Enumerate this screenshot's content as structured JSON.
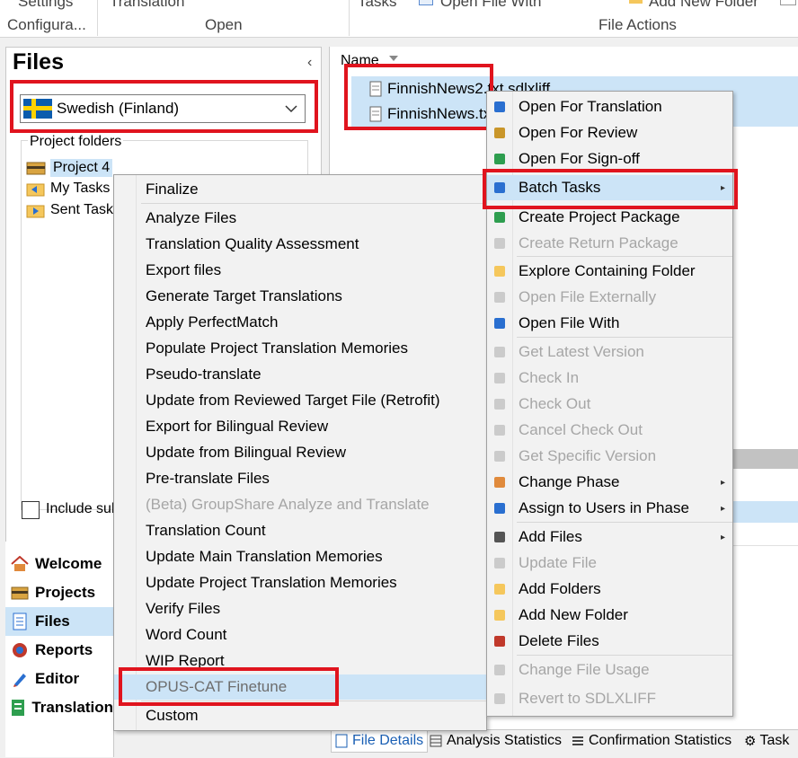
{
  "ribbon": {
    "group_settings": "Settings",
    "group_translation": "Translation",
    "group_tasks": "Tasks",
    "open_file_with": "Open File With",
    "add_new_folder": "Add New Folder",
    "configuration": "Configura...",
    "open": "Open",
    "file_actions": "File Actions"
  },
  "files_panel": {
    "title": "Files",
    "collapse_glyph": "‹",
    "language": "Swedish (Finland)",
    "project_folders_label": "Project folders",
    "folders": [
      "Project 4",
      "My Tasks",
      "Sent Tasks"
    ],
    "include_subfolders": "Include sub"
  },
  "nav": {
    "items": [
      "Welcome",
      "Projects",
      "Files",
      "Reports",
      "Editor",
      "Translation"
    ]
  },
  "file_list": {
    "column_name": "Name",
    "files": [
      "FinnishNews2.txt.sdlxliff",
      "FinnishNews.txt"
    ]
  },
  "batch_menu": {
    "items": [
      "Finalize",
      "Analyze Files",
      "Translation Quality Assessment",
      "Export files",
      "Generate Target Translations",
      "Apply PerfectMatch",
      "Populate Project Translation Memories",
      "Pseudo-translate",
      "Update from Reviewed Target File (Retrofit)",
      "Export for Bilingual Review",
      "Update from Bilingual Review",
      "Pre-translate Files",
      "(Beta) GroupShare Analyze and Translate",
      "Translation Count",
      "Update Main Translation Memories",
      "Update Project Translation Memories",
      "Verify Files",
      "Word Count",
      "WIP Report",
      "OPUS-CAT Finetune",
      "Custom"
    ]
  },
  "context_menu": {
    "items": [
      "Open For Translation",
      "Open For Review",
      "Open For Sign-off",
      "Batch Tasks",
      "Create Project Package",
      "Create Return Package",
      "Explore Containing Folder",
      "Open File Externally",
      "Open File With",
      "Get Latest Version",
      "Check In",
      "Check Out",
      "Cancel Check Out",
      "Get Specific Version",
      "Change Phase",
      "Assign to Users in Phase",
      "Add Files",
      "Update File",
      "Add Folders",
      "Add New Folder",
      "Delete Files",
      "Change File Usage",
      "Revert to SDLXLIFF"
    ]
  },
  "status_tabs": [
    "File Details",
    "Analysis Statistics",
    "Confirmation Statistics",
    "Task"
  ],
  "colors": {
    "highlight": "#cce4f7",
    "annotation_red": "#e0141e",
    "disabled_text": "#a6a6a6"
  }
}
